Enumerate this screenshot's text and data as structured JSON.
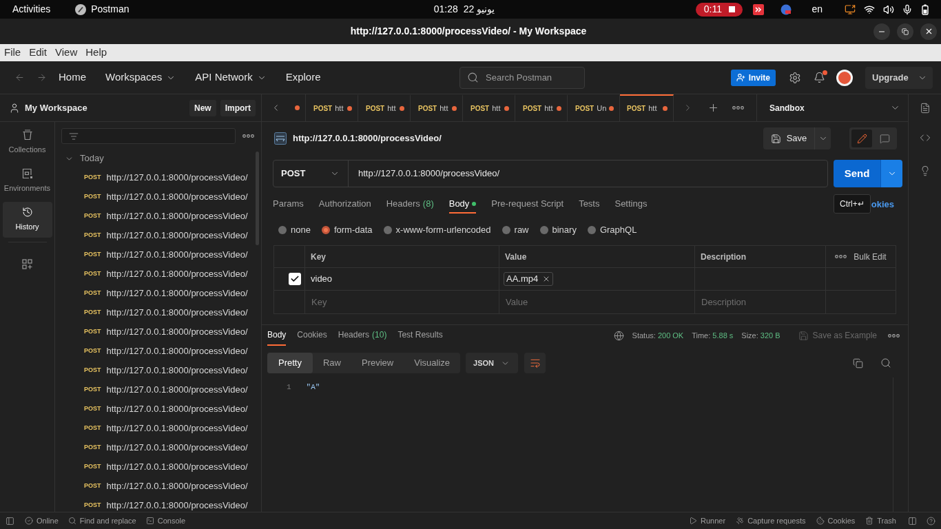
{
  "system_bar": {
    "activities": "Activities",
    "app": "Postman",
    "time": "01:28",
    "date": "22 يونيو",
    "recording": "0:11",
    "keyboard_layout": "en"
  },
  "window": {
    "title": "http://127.0.0.1:8000/processVideo/ - My Workspace"
  },
  "menu_bar": [
    "File",
    "Edit",
    "View",
    "Help"
  ],
  "header": {
    "nav": [
      {
        "label": "Home",
        "dropdown": false
      },
      {
        "label": "Workspaces",
        "dropdown": true
      },
      {
        "label": "API Network",
        "dropdown": true
      },
      {
        "label": "Explore",
        "dropdown": false
      }
    ],
    "search": {
      "placeholder": "Search Postman"
    },
    "invite": "Invite",
    "notifications_unread": true,
    "upgrade": "Upgrade"
  },
  "sidebar": {
    "workspace": "My Workspace",
    "buttons": [
      "New",
      "Import"
    ],
    "rail": [
      {
        "kind": "collections",
        "label": "Collections",
        "selected": false
      },
      {
        "kind": "environments",
        "label": "Environments",
        "selected": false
      },
      {
        "kind": "history",
        "label": "History",
        "selected": true
      }
    ],
    "history": {
      "group": "Today",
      "expanded": true,
      "items": [
        {
          "method": "POST",
          "url": "http://127.0.0.1:8000/processVideo/"
        },
        {
          "method": "POST",
          "url": "http://127.0.0.1:8000/processVideo/"
        },
        {
          "method": "POST",
          "url": "http://127.0.0.1:8000/processVideo/"
        },
        {
          "method": "POST",
          "url": "http://127.0.0.1:8000/processVideo/"
        },
        {
          "method": "POST",
          "url": "http://127.0.0.1:8000/processVideo/"
        },
        {
          "method": "POST",
          "url": "http://127.0.0.1:8000/processVideo/"
        },
        {
          "method": "POST",
          "url": "http://127.0.0.1:8000/processVideo/"
        },
        {
          "method": "POST",
          "url": "http://127.0.0.1:8000/processVideo/"
        },
        {
          "method": "POST",
          "url": "http://127.0.0.1:8000/processVideo/"
        },
        {
          "method": "POST",
          "url": "http://127.0.0.1:8000/processVideo/"
        },
        {
          "method": "POST",
          "url": "http://127.0.0.1:8000/processVideo/"
        },
        {
          "method": "POST",
          "url": "http://127.0.0.1:8000/processVideo/"
        },
        {
          "method": "POST",
          "url": "http://127.0.0.1:8000/processVideo/"
        },
        {
          "method": "POST",
          "url": "http://127.0.0.1:8000/processVideo/"
        },
        {
          "method": "POST",
          "url": "http://127.0.0.1:8000/processVideo/"
        },
        {
          "method": "POST",
          "url": "http://127.0.0.1:8000/processVideo/"
        },
        {
          "method": "POST",
          "url": "http://127.0.0.1:8000/processVideo/"
        },
        {
          "method": "POST",
          "url": "http://127.0.0.1:8000/processVideo/"
        }
      ]
    }
  },
  "tab_bar": {
    "partial_tab": {
      "unsaved": true
    },
    "tabs": [
      {
        "method": "POST",
        "name": "htt",
        "unsaved": true,
        "selected": false
      },
      {
        "method": "POST",
        "name": "htt",
        "unsaved": true,
        "selected": false
      },
      {
        "method": "POST",
        "name": "htt",
        "unsaved": true,
        "selected": false
      },
      {
        "method": "POST",
        "name": "htt",
        "unsaved": true,
        "selected": false
      },
      {
        "method": "POST",
        "name": "htt",
        "unsaved": true,
        "selected": false
      },
      {
        "method": "POST",
        "name": "Un",
        "unsaved": true,
        "selected": false
      },
      {
        "method": "POST",
        "name": "htt",
        "unsaved": true,
        "selected": true
      }
    ],
    "environment": "Sandbox"
  },
  "request": {
    "title": "http://127.0.0.1:8000/processVideo/",
    "save": "Save",
    "modes": [
      {
        "kind": "edit",
        "selected": true
      },
      {
        "kind": "comments",
        "selected": false
      }
    ],
    "method": "POST",
    "url": "http://127.0.0.1:8000/processVideo/",
    "send": "Send",
    "tooltip": "Ctrl+↵",
    "tabs": [
      {
        "label": "Params",
        "selected": false,
        "indicator": false
      },
      {
        "label": "Authorization",
        "selected": false,
        "indicator": false
      },
      {
        "label": "Headers",
        "count": "(8)",
        "selected": false,
        "indicator": false
      },
      {
        "label": "Body",
        "selected": true,
        "indicator": true
      },
      {
        "label": "Pre-request Script",
        "selected": false,
        "indicator": false
      },
      {
        "label": "Tests",
        "selected": false,
        "indicator": false
      },
      {
        "label": "Settings",
        "selected": false,
        "indicator": false
      }
    ],
    "cookies_link": "okies",
    "body_types": [
      {
        "label": "none",
        "selected": false
      },
      {
        "label": "form-data",
        "selected": true
      },
      {
        "label": "x-www-form-urlencoded",
        "selected": false
      },
      {
        "label": "raw",
        "selected": false
      },
      {
        "label": "binary",
        "selected": false
      },
      {
        "label": "GraphQL",
        "selected": false
      }
    ],
    "table": {
      "columns": [
        "Key",
        "Value",
        "Description"
      ],
      "bulk_edit": "Bulk Edit",
      "rows": [
        {
          "checked": true,
          "key": "video",
          "file": "AA.mp4"
        }
      ],
      "empty_row": [
        {
          "placeholder": "Key"
        },
        {
          "placeholder": "Value"
        },
        {
          "placeholder": "Description"
        }
      ]
    }
  },
  "response": {
    "tabs": [
      {
        "label": "Body",
        "selected": true
      },
      {
        "label": "Cookies",
        "selected": false
      },
      {
        "label": "Headers",
        "count": "(10)",
        "selected": false
      },
      {
        "label": "Test Results",
        "selected": false
      }
    ],
    "meta": [
      {
        "label": "Status:",
        "value": "200 OK"
      },
      {
        "label": "Time:",
        "value": "5.88 s"
      },
      {
        "label": "Size:",
        "value": "320 B"
      }
    ],
    "save_example": {
      "label": "Save as Example",
      "disabled": true
    },
    "views": [
      {
        "label": "Pretty",
        "selected": true
      },
      {
        "label": "Raw",
        "selected": false
      },
      {
        "label": "Preview",
        "selected": false
      },
      {
        "label": "Visualize",
        "selected": false
      }
    ],
    "format": "JSON",
    "wrap_lines": true,
    "lines": [
      {
        "number": "1",
        "text": "\"A\""
      }
    ]
  },
  "status_bar": {
    "left": [
      {
        "kind": "online",
        "label": "Online"
      },
      {
        "kind": "find",
        "label": "Find and replace"
      },
      {
        "kind": "console",
        "label": "Console"
      }
    ],
    "right": [
      {
        "kind": "runner",
        "label": "Runner"
      },
      {
        "kind": "capture",
        "label": "Capture requests"
      },
      {
        "kind": "cookies",
        "label": "Cookies"
      },
      {
        "kind": "trash",
        "label": "Trash"
      }
    ]
  }
}
